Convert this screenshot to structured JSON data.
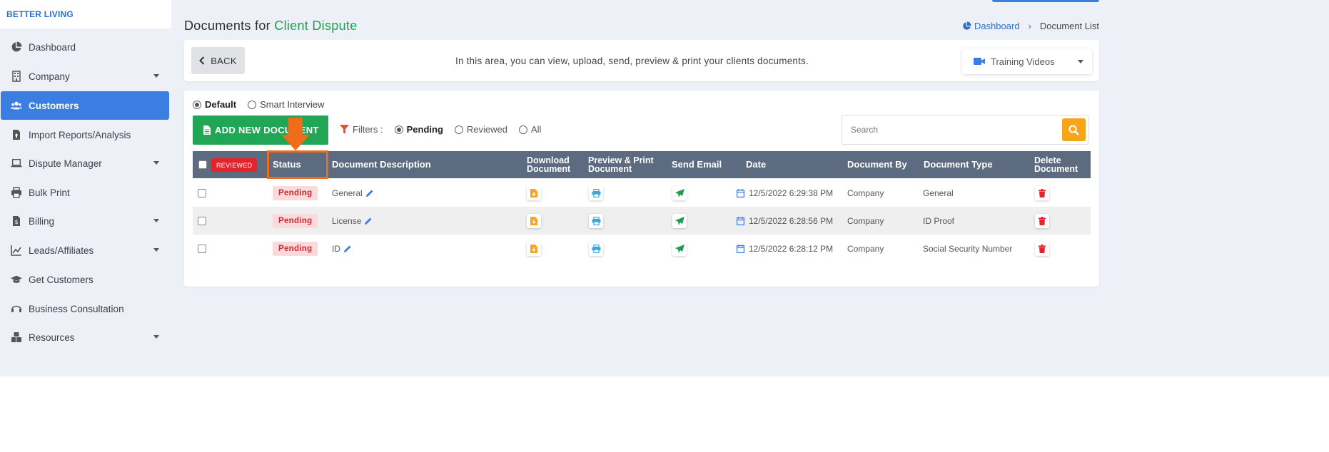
{
  "brand": {
    "name": "BETTER LIVING"
  },
  "sidebar": {
    "items": [
      {
        "label": "Dashboard",
        "icon": "pie-chart-icon"
      },
      {
        "label": "Company",
        "icon": "building-icon",
        "has_caret": true
      },
      {
        "label": "Customers",
        "icon": "users-icon",
        "active": true
      },
      {
        "label": "Import Reports/Analysis",
        "icon": "file-upload-icon"
      },
      {
        "label": "Dispute Manager",
        "icon": "laptop-icon",
        "has_caret": true
      },
      {
        "label": "Bulk Print",
        "icon": "printer-icon"
      },
      {
        "label": "Billing",
        "icon": "invoice-icon",
        "has_caret": true
      },
      {
        "label": "Leads/Affiliates",
        "icon": "chart-line-icon",
        "has_caret": true
      },
      {
        "label": "Get Customers",
        "icon": "graduation-cap-icon"
      },
      {
        "label": "Business Consultation",
        "icon": "headset-icon"
      },
      {
        "label": "Resources",
        "icon": "boxes-icon",
        "has_caret": true
      }
    ]
  },
  "header": {
    "title_prefix": "Documents for",
    "title_accent": "Client Dispute",
    "breadcrumb": {
      "home": "Dashboard",
      "current": "Document List"
    }
  },
  "info": {
    "back_label": "BACK",
    "text": "In this area, you can view, upload, send, preview & print your clients documents.",
    "training_label": "Training Videos"
  },
  "mode": {
    "options": [
      "Default",
      "Smart Interview"
    ],
    "selected": "Default"
  },
  "toolbar": {
    "add_label": "ADD NEW DOCUMENT",
    "filters_label": "Filters :",
    "filter_options": [
      "Pending",
      "Reviewed",
      "All"
    ],
    "selected_filter": "Pending",
    "search_placeholder": "Search"
  },
  "table": {
    "reviewed_badge": "REVIEWED",
    "headers": {
      "status": "Status",
      "description": "Document Description",
      "download_1": "Download",
      "download_2": "Document",
      "preview_1": "Preview & Print",
      "preview_2": "Document",
      "email": "Send Email",
      "date": "Date",
      "by": "Document By",
      "type": "Document Type",
      "delete_1": "Delete",
      "delete_2": "Document"
    },
    "rows": [
      {
        "status": "Pending",
        "description": "General",
        "date": "12/5/2022 6:29:38 PM",
        "by": "Company",
        "type": "General"
      },
      {
        "status": "Pending",
        "description": "License",
        "date": "12/5/2022 6:28:56 PM",
        "by": "Company",
        "type": "ID Proof"
      },
      {
        "status": "Pending",
        "description": "ID",
        "date": "12/5/2022 6:28:12 PM",
        "by": "Company",
        "type": "Social Security Number"
      }
    ]
  },
  "colors": {
    "primary": "#3b7de0",
    "success": "#21a655",
    "accent_title": "#1f9d50",
    "warning": "#f7a41d",
    "danger": "#e3242b",
    "highlight": "#ef6c1b",
    "table_header": "#5d6b80"
  }
}
